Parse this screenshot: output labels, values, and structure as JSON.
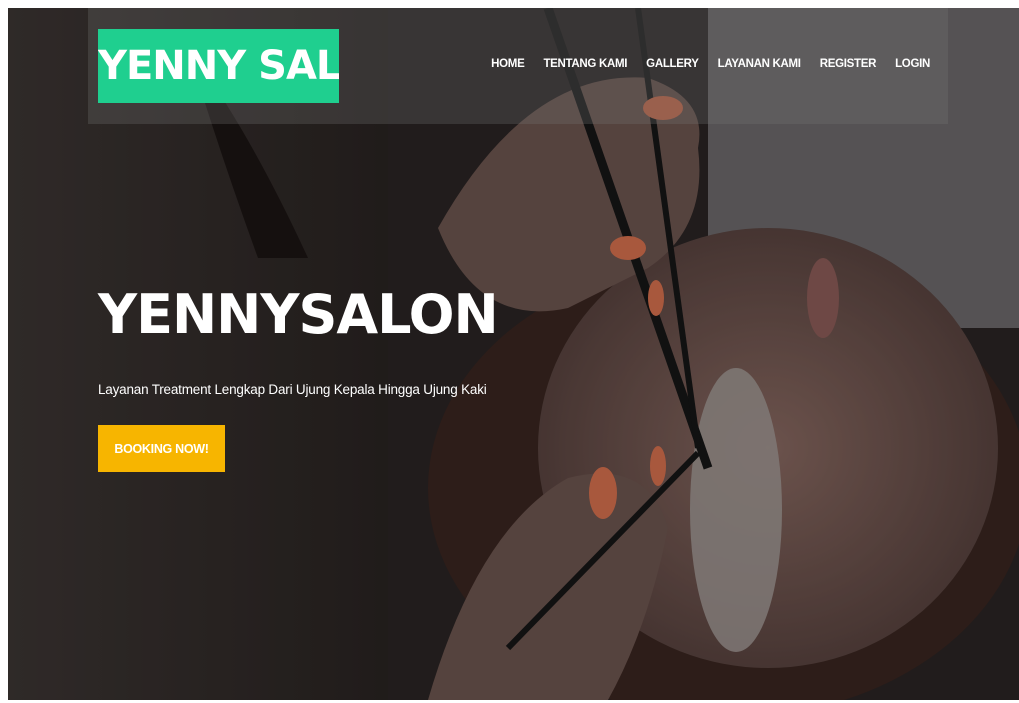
{
  "brand": {
    "logo_text": "YENNY SALON",
    "accent_color": "#1fcf8f"
  },
  "nav": {
    "items": [
      {
        "label": "HOME"
      },
      {
        "label": "TENTANG KAMI"
      },
      {
        "label": "GALLERY"
      },
      {
        "label": "LAYANAN KAMI"
      },
      {
        "label": "REGISTER"
      },
      {
        "label": "LOGIN"
      }
    ]
  },
  "hero": {
    "background_image": "eyelash-extension-treatment-photo",
    "title": "YENNYSALON",
    "subtitle": "Layanan Treatment Lengkap Dari Ujung Kepala Hingga Ujung Kaki",
    "cta_label": "BOOKING NOW!",
    "cta_color": "#f7b500"
  }
}
